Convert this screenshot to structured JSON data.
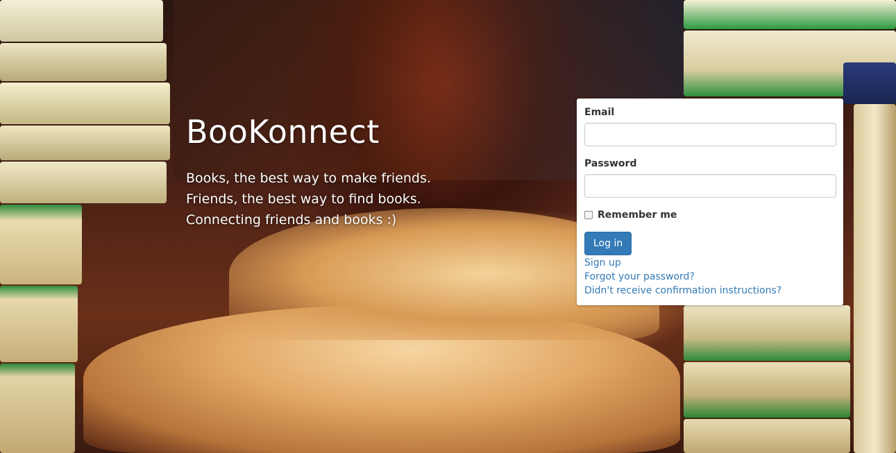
{
  "app": {
    "title": "BooKonnect",
    "tagline": [
      "Books, the best way to make friends.",
      "Friends, the best way to find books.",
      "Connecting friends and books :)"
    ]
  },
  "login": {
    "email_label": "Email",
    "email_value": "",
    "password_label": "Password",
    "password_value": "",
    "remember_label": "Remember me",
    "remember_checked": false,
    "submit_label": "Log in",
    "links": {
      "sign_up": "Sign up",
      "forgot_password": "Forgot your password?",
      "confirmation": "Didn't receive confirmation instructions?"
    }
  },
  "colors": {
    "primary": "#337ab7",
    "link": "#337ab7",
    "label_text": "#333333",
    "hero_text": "#ffffff"
  }
}
